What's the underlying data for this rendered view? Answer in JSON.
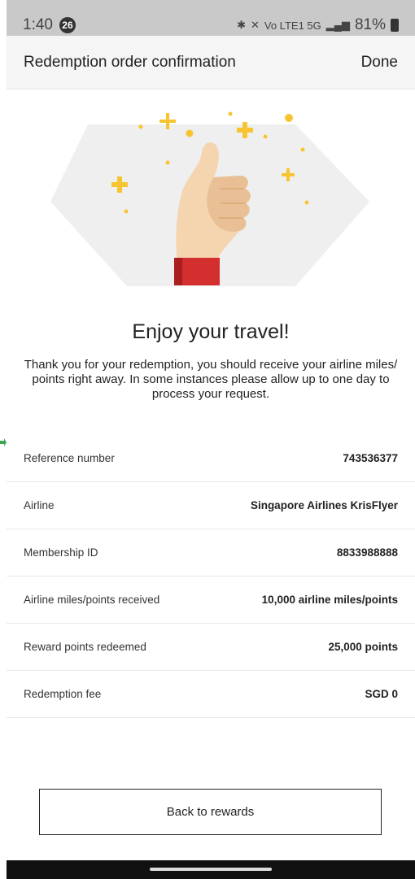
{
  "status_bar": {
    "time": "1:40",
    "notification_count": "26",
    "network_text": "Vo LTE1 5G",
    "battery_percent": "81%"
  },
  "app_bar": {
    "title": "Redemption order confirmation",
    "done_label": "Done"
  },
  "content": {
    "headline": "Enjoy your travel!",
    "message": "Thank you for your redemption, you should receive your airline miles/ points right away. In some instances please allow up to one day to process your request."
  },
  "details": [
    {
      "label": "Reference number",
      "value": "743536377"
    },
    {
      "label": "Airline",
      "value": "Singapore Airlines KrisFlyer"
    },
    {
      "label": "Membership ID",
      "value": "8833988888"
    },
    {
      "label": "Airline miles/points received",
      "value": "10,000 airline miles/points"
    },
    {
      "label": "Reward points redeemed",
      "value": "25,000 points"
    },
    {
      "label": "Redemption fee",
      "value": "SGD 0"
    }
  ],
  "footer": {
    "back_button_label": "Back to rewards"
  },
  "colors": {
    "accent_yellow": "#f7c531",
    "sleeve_red": "#d32f2f",
    "skin": "#f4d5b0",
    "illustration_bg": "#efefef"
  }
}
